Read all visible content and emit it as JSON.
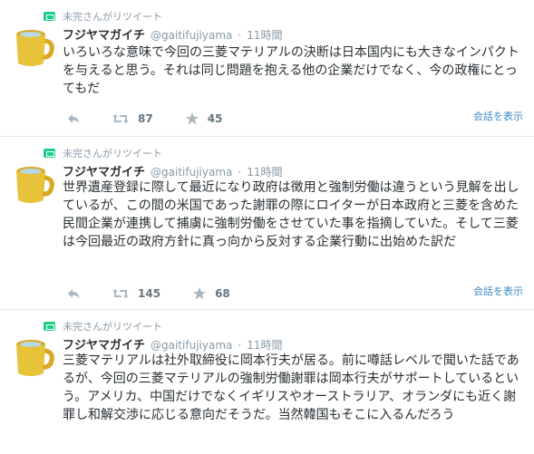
{
  "colors": {
    "retweet": "#19cf86",
    "link": "#3b88c3",
    "muted": "#8899a6",
    "mug": "#e7c33a"
  },
  "tweets": [
    {
      "retweeted_by": "未完さんがリツイート",
      "display_name": "フジヤマガイチ",
      "handle": "@gaitifujiyama",
      "time": "11時間",
      "text": "いろいろな意味で今回の三菱マテリアルの決断は日本国内にも大きなインパクトを与えると思う。それは同じ問題を抱える他の企業だけでなく、今の政権にとってもだ",
      "retweets": "87",
      "likes": "45",
      "conversation": "会話を表示"
    },
    {
      "retweeted_by": "未完さんがリツイート",
      "display_name": "フジヤマガイチ",
      "handle": "@gaitifujiyama",
      "time": "11時間",
      "text": "世界遺産登録に際して最近になり政府は徴用と強制労働は違うという見解を出しているが、この間の米国であった謝罪の際にロイターが日本政府と三菱を含めた民間企業が連携して捕虜に強制労働をさせていた事を指摘していた。そして三菱は今回最近の政府方針に真っ向から反対する企業行動に出始めた訳だ",
      "retweets": "145",
      "likes": "68",
      "conversation": "会話を表示"
    },
    {
      "retweeted_by": "未完さんがリツイート",
      "display_name": "フジヤマガイチ",
      "handle": "@gaitifujiyama",
      "time": "11時間",
      "text": "三菱マテリアルは社外取締役に岡本行夫が居る。前に噂話レベルで聞いた話であるが、今回の三菱マテリアルの強制労働謝罪は岡本行夫がサポートしているという。アメリカ、中国だけでなくイギリスやオーストラリア、オランダにも近く謝罪し和解交渉に応じる意向だそうだ。当然韓国もそこに入るんだろう"
    }
  ]
}
